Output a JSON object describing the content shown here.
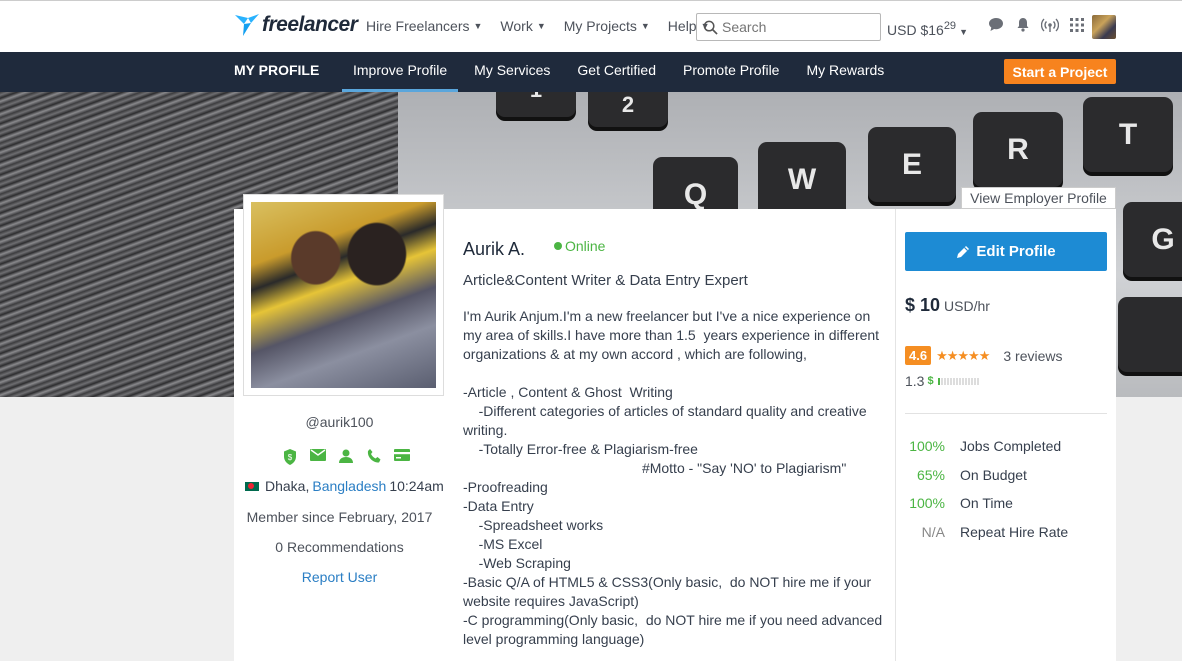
{
  "topbar": {
    "logo_text": "freelancer",
    "nav": [
      "Hire Freelancers",
      "Work",
      "My Projects",
      "Help"
    ],
    "search_placeholder": "Search",
    "balance_main": "USD $16",
    "balance_cents": "29",
    "icons": [
      "chat-icon",
      "bell-icon",
      "signal-icon",
      "apps-grid-icon"
    ]
  },
  "profile_nav": {
    "title": "MY PROFILE",
    "tabs": [
      "Improve Profile",
      "My Services",
      "Get Certified",
      "Promote Profile",
      "My Rewards"
    ],
    "active_tab": "Improve Profile",
    "cta": "Start a Project"
  },
  "banner": {
    "keys": [
      "1",
      "2",
      "Q",
      "W",
      "E",
      "R",
      "T",
      "G"
    ]
  },
  "view_employer_label": "View Employer Profile",
  "left": {
    "username": "@aurik100",
    "verification_icons": [
      "shield-check-icon",
      "email-icon",
      "user-icon",
      "phone-icon",
      "credit-card-icon"
    ],
    "city": "Dhaka,",
    "country": "Bangladesh",
    "local_time": "10:24am",
    "member_since": "Member since February, 2017",
    "recommendations": "0 Recommendations",
    "report": "Report User"
  },
  "profile": {
    "name": "Aurik A.",
    "status": "Online",
    "tagline": "Article&Content Writer & Data Entry Expert",
    "bio": "I'm Aurik Anjum.I'm a new freelancer but I've a nice experience on\nmy area of skills.I have more than 1.5  years experience in different\norganizations & at my own accord , which are following,\n\n-Article , Content & Ghost  Writing\n    -Different categories of articles of standard quality and creative\nwriting.\n    -Totally Error-free & Plagiarism-free\n                                              #Motto - \"Say 'NO' to Plagiarism\"\n-Proofreading\n-Data Entry\n    -Spreadsheet works\n    -MS Excel\n    -Web Scraping\n-Basic Q/A of HTML5 & CSS3(Only basic,  do NOT hire me if your\nwebsite requires JavaScript)\n-C programming(Only basic,  do NOT hire me if you need advanced\nlevel programming language)"
  },
  "right": {
    "edit_label": "Edit Profile",
    "rate_value": "$ 10",
    "rate_unit": "USD/hr",
    "rating": "4.6",
    "stars": "★★★★★",
    "reviews": "3 reviews",
    "earnings_score": "1.3",
    "earnings_symbol": "$",
    "earnings_level": 0.1,
    "stats": [
      {
        "value": "100%",
        "label": "Jobs Completed"
      },
      {
        "value": "65%",
        "label": "On Budget"
      },
      {
        "value": "100%",
        "label": "On Time"
      },
      {
        "value": "N/A",
        "label": "Repeat Hire Rate"
      }
    ],
    "colors": {
      "accent_green": "#4bb543",
      "accent_orange": "#f58e22",
      "accent_blue": "#1d8bd4",
      "nav_bg": "#1f2a3c"
    }
  }
}
